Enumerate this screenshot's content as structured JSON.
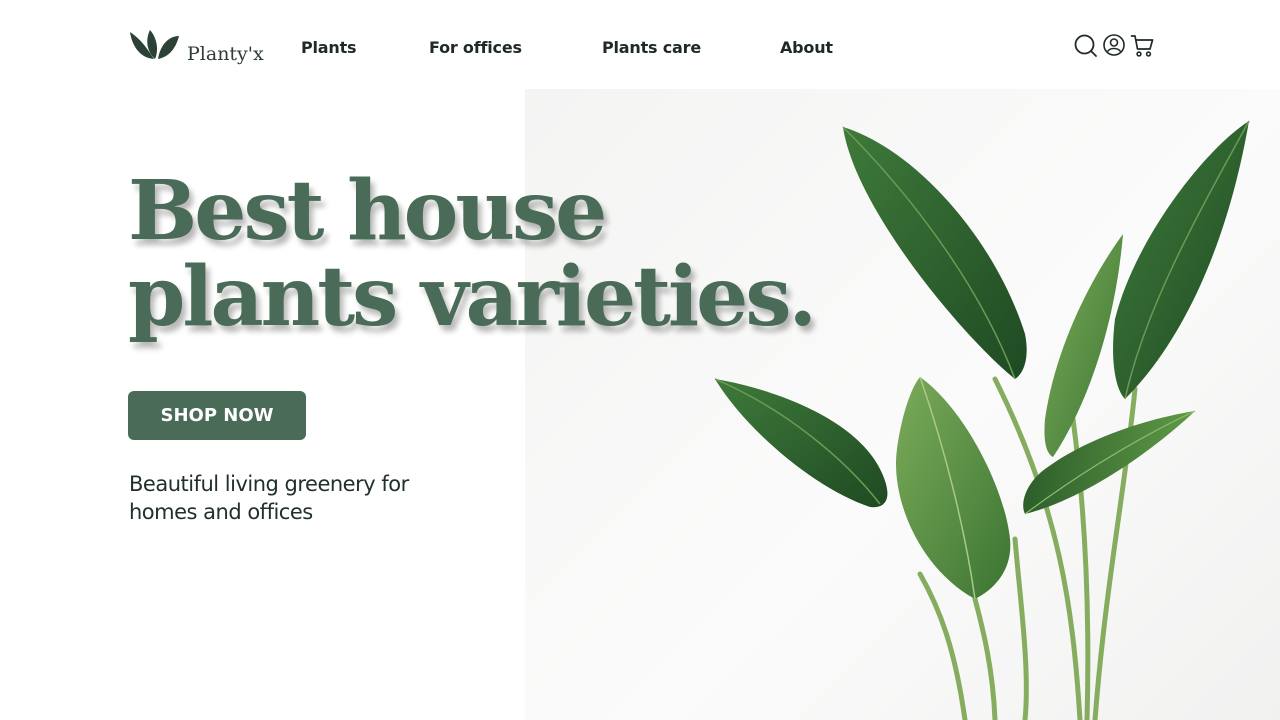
{
  "brand": {
    "name": "Planty'x",
    "logo_icon": "leaf-logo-icon"
  },
  "nav": {
    "items": [
      {
        "label": "Plants"
      },
      {
        "label": "For offices"
      },
      {
        "label": "Plants care"
      },
      {
        "label": "About"
      }
    ]
  },
  "header_icons": {
    "search": "search-icon",
    "account": "user-icon",
    "cart": "cart-icon"
  },
  "hero": {
    "headline_line1": "Best house",
    "headline_line2": "plants varieties.",
    "cta_label": "SHOP NOW",
    "tagline": "Beautiful living greenery for homes and offices",
    "image_subject": "potted green leafy plant"
  },
  "colors": {
    "brand_green": "#4a6b58",
    "text_dark": "#1f2a24",
    "background": "#ffffff"
  }
}
